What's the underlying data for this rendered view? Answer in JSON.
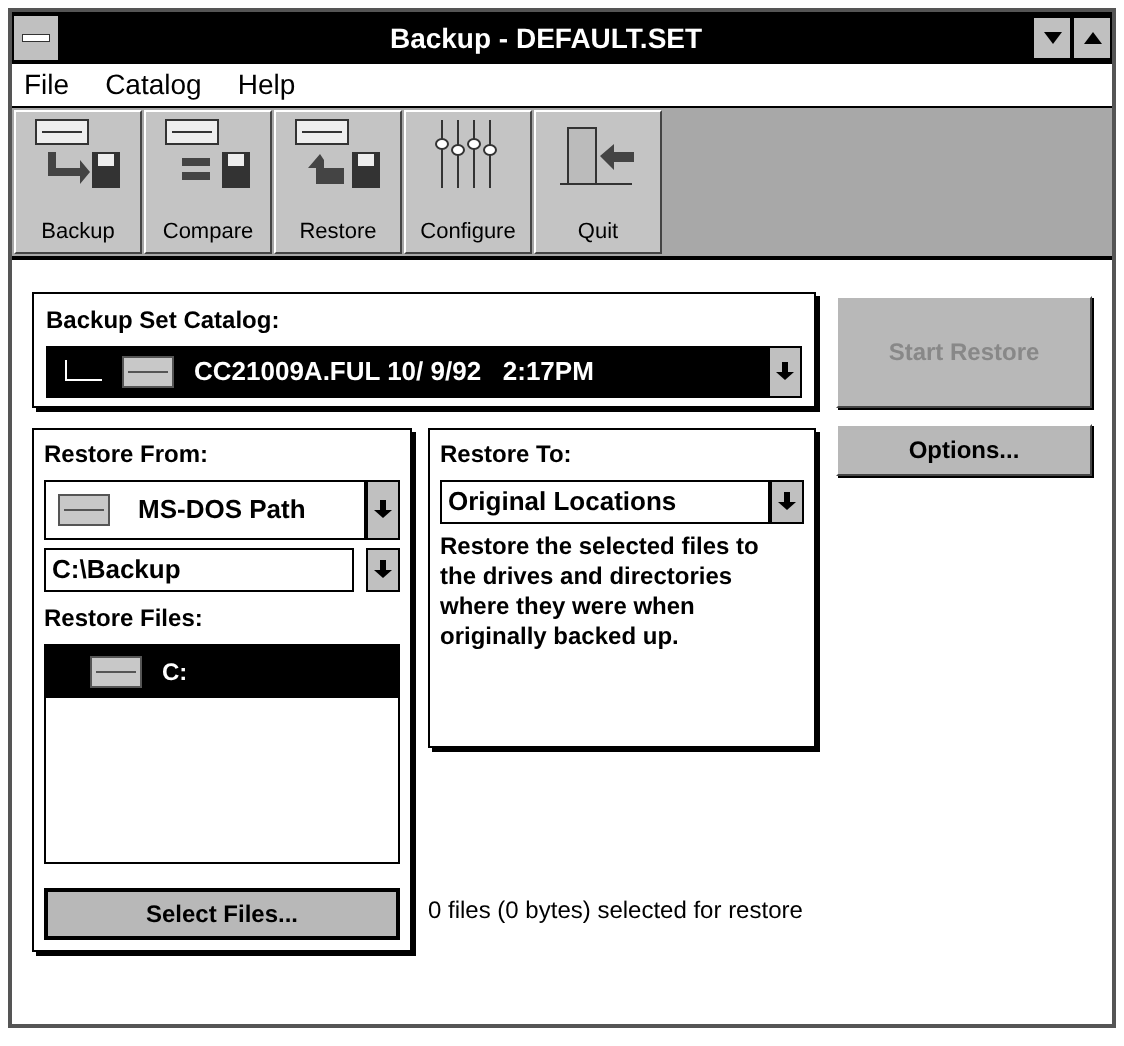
{
  "window": {
    "title": "Backup - DEFAULT.SET"
  },
  "menu": [
    "File",
    "Catalog",
    "Help"
  ],
  "toolbar": [
    {
      "label": "Backup"
    },
    {
      "label": "Compare"
    },
    {
      "label": "Restore"
    },
    {
      "label": "Configure"
    },
    {
      "label": "Quit"
    }
  ],
  "catalog": {
    "label": "Backup Set Catalog:",
    "value": "CC21009A.FUL 10/ 9/92   2:17PM"
  },
  "buttons": [
    {
      "label": "Start Restore",
      "disabled": true
    },
    {
      "label": "Options...",
      "disabled": false
    }
  ],
  "restore_from": {
    "label": "Restore From:",
    "source": "MS-DOS Path",
    "path": "C:\\Backup",
    "files_label": "Restore Files:",
    "files": [
      {
        "label": "C:",
        "selected": true
      }
    ],
    "button": "Select Files..."
  },
  "restore_to": {
    "label": "Restore To:",
    "value": "Original Locations",
    "description": "Restore the selected files to the drives and directories where they were when originally backed up."
  },
  "status": "0 files (0 bytes) selected for restore"
}
